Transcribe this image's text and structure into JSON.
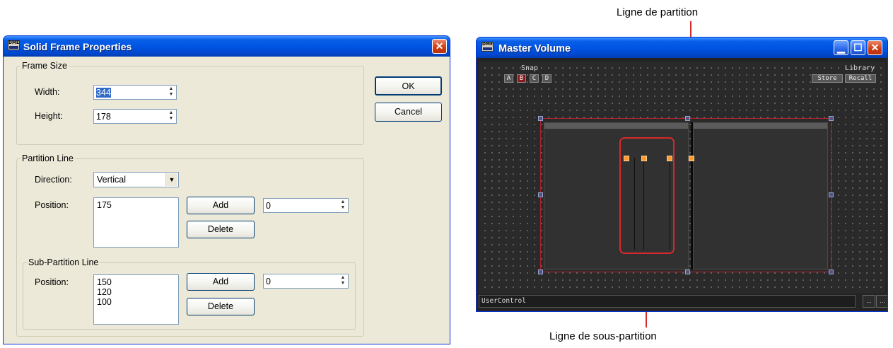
{
  "dialog": {
    "title": "Solid Frame Properties",
    "icon_text": "DME",
    "frame_size": {
      "group_label": "Frame Size",
      "width_label": "Width:",
      "width_value": "344",
      "height_label": "Height:",
      "height_value": "178"
    },
    "partition_line": {
      "group_label": "Partition Line",
      "direction_label": "Direction:",
      "direction_value": "Vertical",
      "position_label": "Position:",
      "positions": [
        "175"
      ],
      "add_label": "Add",
      "delete_label": "Delete",
      "value": "0"
    },
    "sub_partition_line": {
      "group_label": "Sub-Partition Line",
      "position_label": "Position:",
      "positions": [
        "150",
        "120",
        "100"
      ],
      "add_label": "Add",
      "delete_label": "Delete",
      "value": "0"
    },
    "ok_label": "OK",
    "cancel_label": "Cancel",
    "close_glyph": "✕"
  },
  "master_volume": {
    "title": "Master Volume",
    "icon_text": "DME",
    "snap_label": "Snap",
    "snap_buttons": [
      "A",
      "B",
      "C",
      "D"
    ],
    "snap_selected": "B",
    "library_label": "Library",
    "store_label": "Store",
    "recall_label": "Recall",
    "status_text": "UserControl",
    "status_btn": "...",
    "min_glyph": "▁",
    "max_glyph": "☐",
    "close_glyph": "✕"
  },
  "callouts": {
    "partition_line": "Ligne de partition",
    "sub_partition_line": "Ligne de sous-partition"
  },
  "colors": {
    "xp_title_blue": "#0054e3",
    "dialog_face": "#ece9d8",
    "highlight_red": "#d42a2a",
    "handle_orange": "#ff9a2e"
  }
}
